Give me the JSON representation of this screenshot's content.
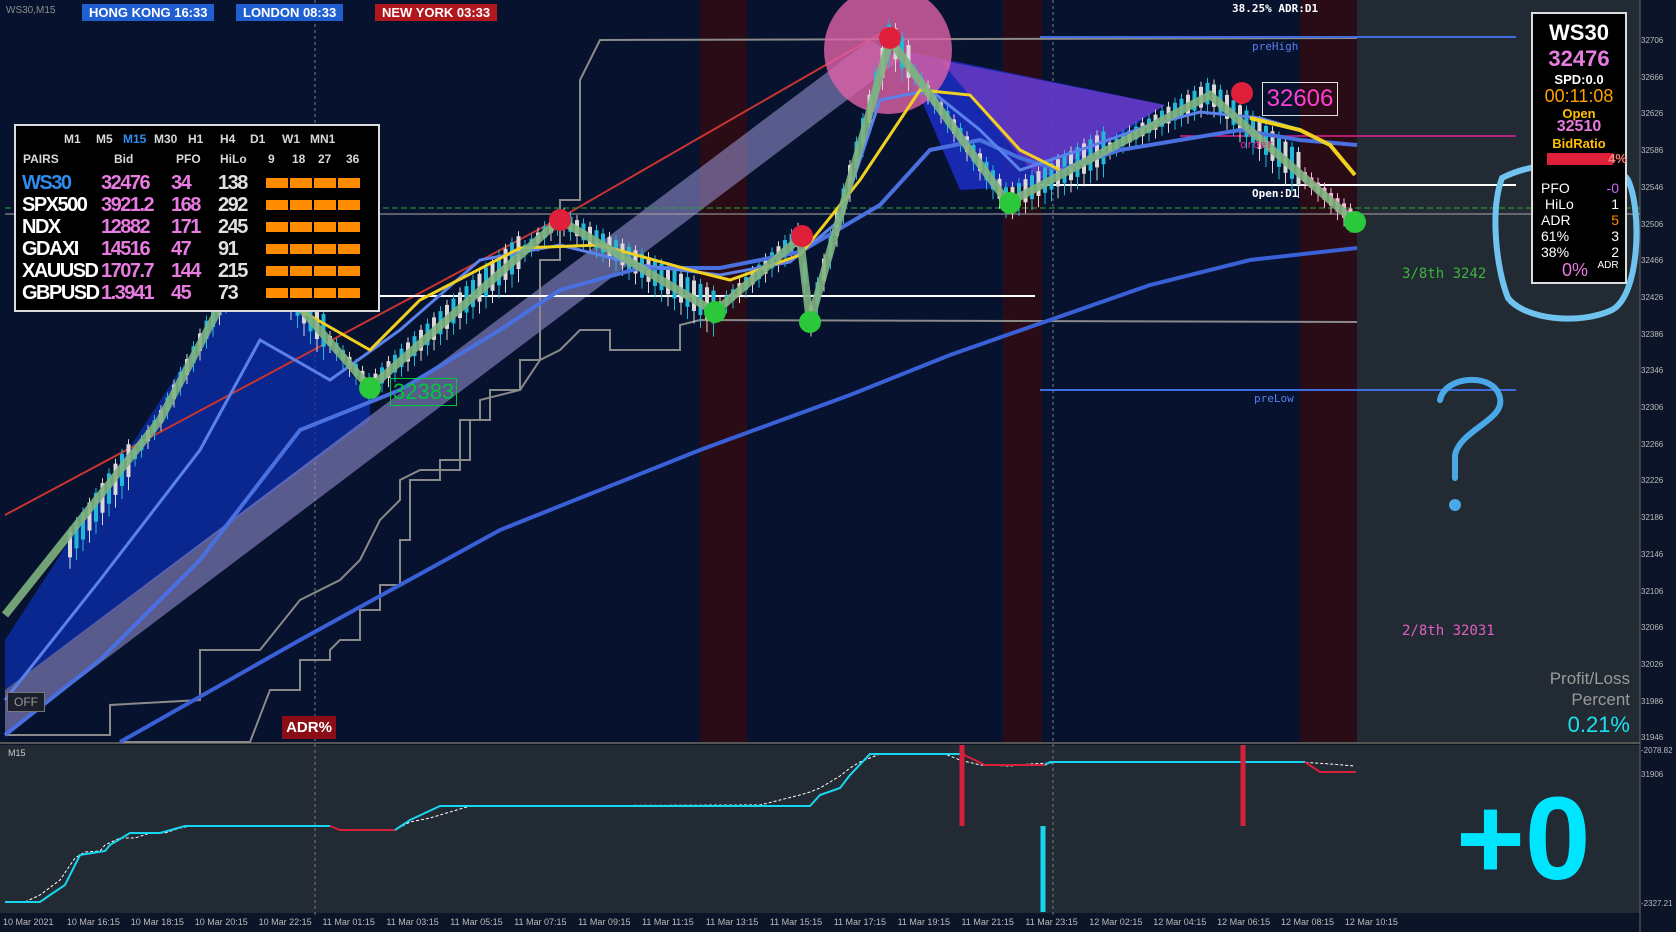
{
  "symbol_label": "WS30,M15",
  "sessions": [
    {
      "label": "HONG KONG 16:33",
      "color": "#1f5fd0"
    },
    {
      "label": "LONDON 08:33",
      "color": "#1f5fd0"
    },
    {
      "label": "NEW YORK 03:33",
      "color": "#b0181e"
    }
  ],
  "adr_top": "38.25% ADR:D1",
  "levels": {
    "pre_high": "preHigh",
    "pre_low": "preLow",
    "open_d1": "Open:D1",
    "order": "order",
    "eighth_3": "3/8th  3242",
    "eighth_2": "2/8th  32031"
  },
  "price_tag": "32606",
  "low_label": "32383",
  "price_axis": [
    "32706",
    "32666",
    "32626",
    "32586",
    "32546",
    "32506",
    "32466",
    "32426",
    "32386",
    "32346",
    "32306",
    "32266",
    "32226",
    "32186",
    "32146",
    "32106",
    "32066",
    "32026",
    "31986",
    "31946",
    "31906"
  ],
  "sub_axis": [
    "-2078.82",
    "-2327.21"
  ],
  "time_axis": [
    "10 Mar 2021",
    "10 Mar 16:15",
    "10 Mar 18:15",
    "10 Mar 20:15",
    "10 Mar 22:15",
    "11 Mar 01:15",
    "11 Mar 03:15",
    "11 Mar 05:15",
    "11 Mar 07:15",
    "11 Mar 09:15",
    "11 Mar 11:15",
    "11 Mar 13:15",
    "11 Mar 15:15",
    "11 Mar 17:15",
    "11 Mar 19:15",
    "11 Mar 21:15",
    "11 Mar 23:15",
    "12 Mar 02:15",
    "12 Mar 04:15",
    "12 Mar 06:15",
    "12 Mar 08:15",
    "12 Mar 10:15"
  ],
  "pairs_panel": {
    "timeframes": [
      "M1",
      "M5",
      "M15",
      "M30",
      "H1",
      "H4",
      "D1",
      "W1",
      "MN1"
    ],
    "active_tf": "M15",
    "headers": [
      "PAIRS",
      "Bid",
      "PFO",
      "HiLo",
      "9",
      "18",
      "27",
      "36"
    ],
    "rows": [
      {
        "pair": "WS30",
        "bid": "32476",
        "pfo": "34",
        "hilo": "138",
        "active": true
      },
      {
        "pair": "SPX500",
        "bid": "3921.2",
        "pfo": "168",
        "hilo": "292",
        "active": false
      },
      {
        "pair": "NDX",
        "bid": "12882",
        "pfo": "171",
        "hilo": "245",
        "active": false
      },
      {
        "pair": "GDAXI",
        "bid": "14516",
        "pfo": "47",
        "hilo": "91",
        "active": false
      },
      {
        "pair": "XAUUSD",
        "bid": "1707.7",
        "pfo": "144",
        "hilo": "215",
        "active": false
      },
      {
        "pair": "GBPUSD",
        "bid": "1.3941",
        "pfo": "45",
        "hilo": "73",
        "active": false
      }
    ]
  },
  "info_panel": {
    "symbol": "WS30",
    "price": "32476",
    "spread": "SPD:0.0",
    "timer": "00:11:08",
    "open_label": "Open",
    "open_value": "32510",
    "bid_ratio_label": "BidRatio",
    "bid_ratio_value": "4%",
    "stats": [
      {
        "label": "PFO",
        "value": "-0",
        "color": "#cc66ff"
      },
      {
        "label": "HiLo",
        "value": "1",
        "color": "#ffffff"
      },
      {
        "label": "ADR",
        "value": "5",
        "color": "#ff8c00"
      },
      {
        "label": "61%",
        "value": "3",
        "color": "#ffffff"
      },
      {
        "label": "38%",
        "value": "2",
        "color": "#ffffff"
      }
    ],
    "adr_pct": "0%",
    "adr_small": "ADR"
  },
  "pl": {
    "title_line1": "Profit/Loss",
    "title_line2": "Percent",
    "value": "0.21%"
  },
  "big_value": "+0",
  "sub_label": "M15",
  "buttons": {
    "off": "OFF",
    "adr": "ADR%"
  },
  "question_mark": "?"
}
